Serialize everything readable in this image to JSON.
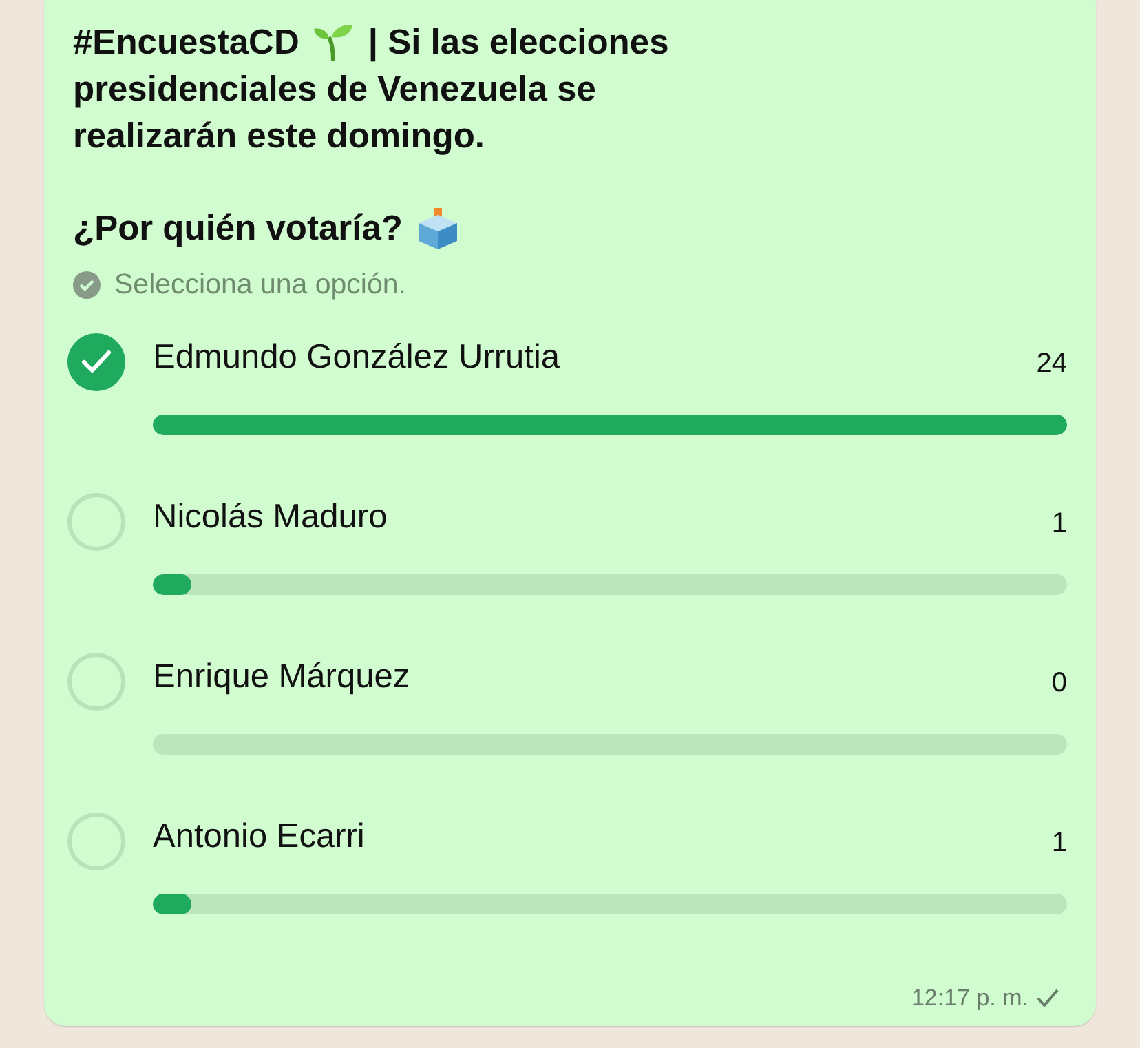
{
  "poll": {
    "title_tag": "#EncuestaCD",
    "title_rest": [
      "| Si las elecciones",
      "presidenciales de Venezuela se realizarán este domingo."
    ],
    "question": "¿Por quién votaría?",
    "hint": "Selecciona una opción.",
    "options": [
      {
        "name": "Edmundo González Urrutia",
        "count": "24",
        "level": 1,
        "selected": true
      },
      {
        "name": "Nicolás Maduro",
        "count": "1",
        "level": 0.042,
        "selected": false
      },
      {
        "name": "Enrique Márquez",
        "count": "0",
        "level": 0,
        "selected": false
      },
      {
        "name": "Antonio Ecarri",
        "count": "1",
        "level": 0.042,
        "selected": false
      }
    ],
    "time": "12:17 p. m.",
    "delivered": true
  }
}
